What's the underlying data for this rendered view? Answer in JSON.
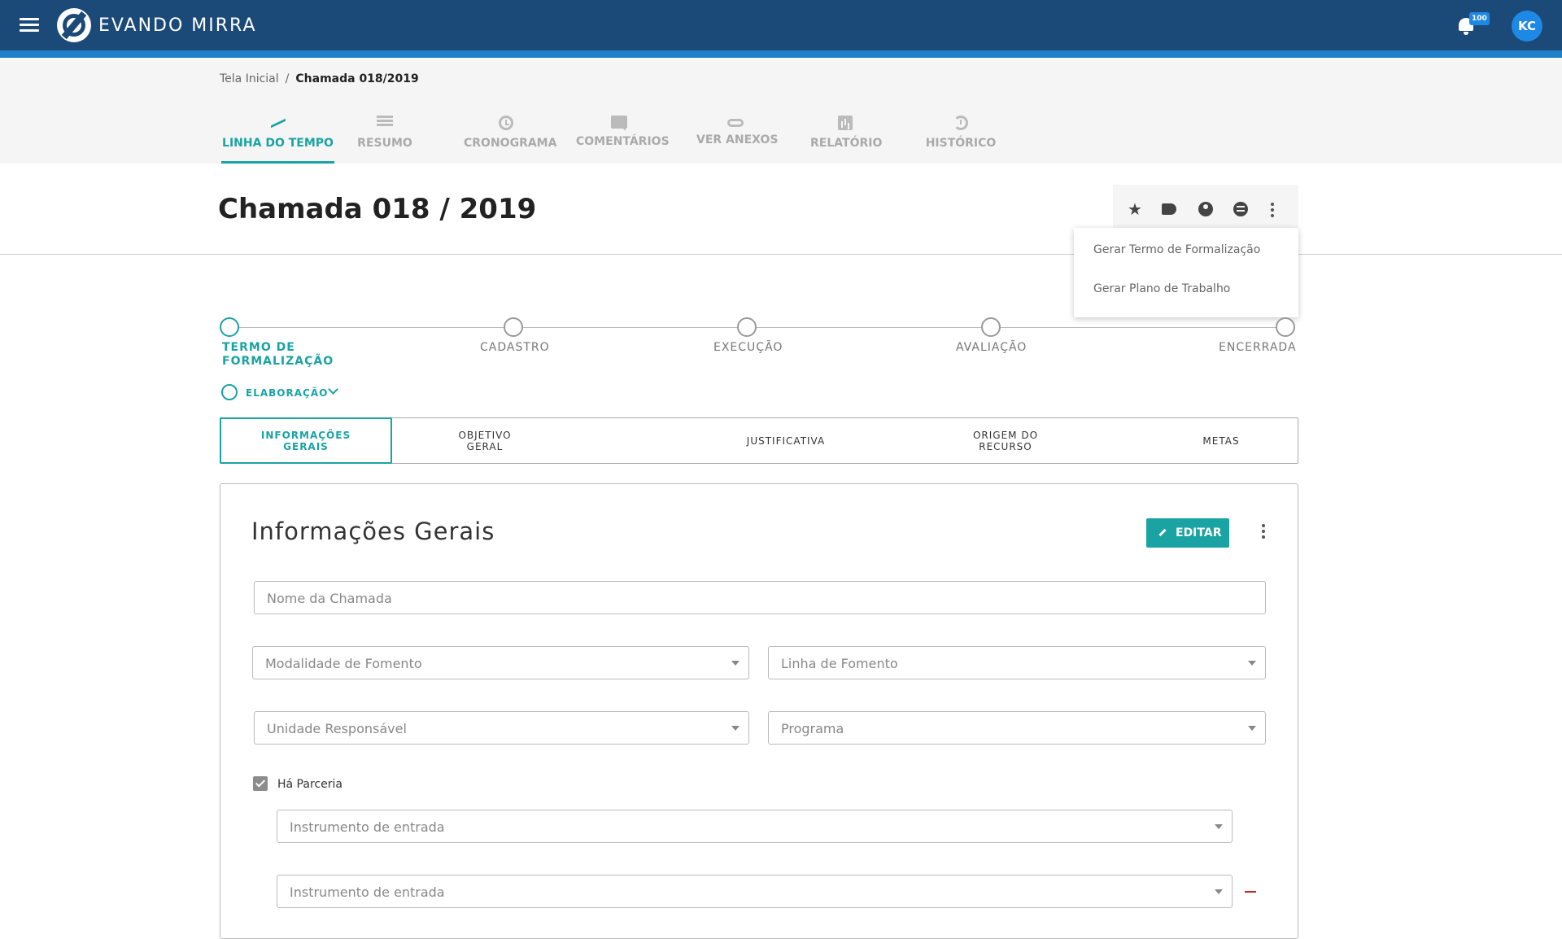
{
  "app": {
    "brand": "EVANDO MIRRA",
    "notification_count": "100",
    "user_initials": "KC"
  },
  "breadcrumb": {
    "home": "Tela Inicial",
    "separator": "/",
    "current": "Chamada 018/2019"
  },
  "tabs": [
    {
      "label": "LINHA DO TEMPO",
      "icon": "timeline-icon",
      "active": true
    },
    {
      "label": "RESUMO",
      "icon": "list-icon"
    },
    {
      "label": "CRONOGRAMA",
      "icon": "alarm-clock-icon"
    },
    {
      "label": "COMENTÁRIOS",
      "icon": "comment-icon"
    },
    {
      "label": "VER ANEXOS",
      "icon": "paperclip-icon"
    },
    {
      "label": "RELATÓRIO",
      "icon": "bar-chart-icon"
    },
    {
      "label": "HISTÓRICO",
      "icon": "history-icon"
    }
  ],
  "page": {
    "title": "Chamada 018 / 2019"
  },
  "actions": {
    "icons": [
      "star-icon",
      "label-icon",
      "account-circle-icon",
      "swap-icon",
      "more-vert-icon"
    ],
    "star_glyph": "★",
    "menu": [
      "Gerar Termo de Formalização",
      "Gerar Plano de Trabalho"
    ]
  },
  "stepper": {
    "steps": [
      {
        "label": "TERMO DE\nFORMALIZAÇÃO",
        "line1": "TERMO DE",
        "line2": "FORMALIZAÇÃO",
        "active": true
      },
      {
        "label": "CADASTRO"
      },
      {
        "label": "EXECUÇÃO"
      },
      {
        "label": "AVALIAÇÃO"
      },
      {
        "label": "ENCERRADA"
      }
    ],
    "sub_step": "ELABORAÇÃO"
  },
  "section_tabs": [
    {
      "line1": "INFORMAÇÕES",
      "line2": "GERAIS",
      "active": true
    },
    {
      "line1": "OBJETIVO",
      "line2": "GERAL"
    },
    {
      "line1": "JUSTIFICATIVA",
      "line2": ""
    },
    {
      "line1": "ORIGEM DO",
      "line2": "RECURSO"
    },
    {
      "line1": "METAS",
      "line2": ""
    }
  ],
  "card": {
    "title": "Informações Gerais",
    "edit_label": "EDITAR",
    "fields": {
      "nome_chamada": "Nome da Chamada",
      "modalidade": "Modalidade de Fomento",
      "linha": "Linha de Fomento",
      "unidade": "Unidade Responsável",
      "programa": "Programa",
      "instrumento_1": "Instrumento de entrada",
      "instrumento_2": "Instrumento de entrada"
    },
    "parceria_label": "Há Parceria",
    "parceria_checked": true
  },
  "colors": {
    "topbar": "#1b4a78",
    "accent_bar": "#1f7fc9",
    "teal": "#1aa3a3",
    "badge": "#1e88e5",
    "remove": "#c62828"
  }
}
